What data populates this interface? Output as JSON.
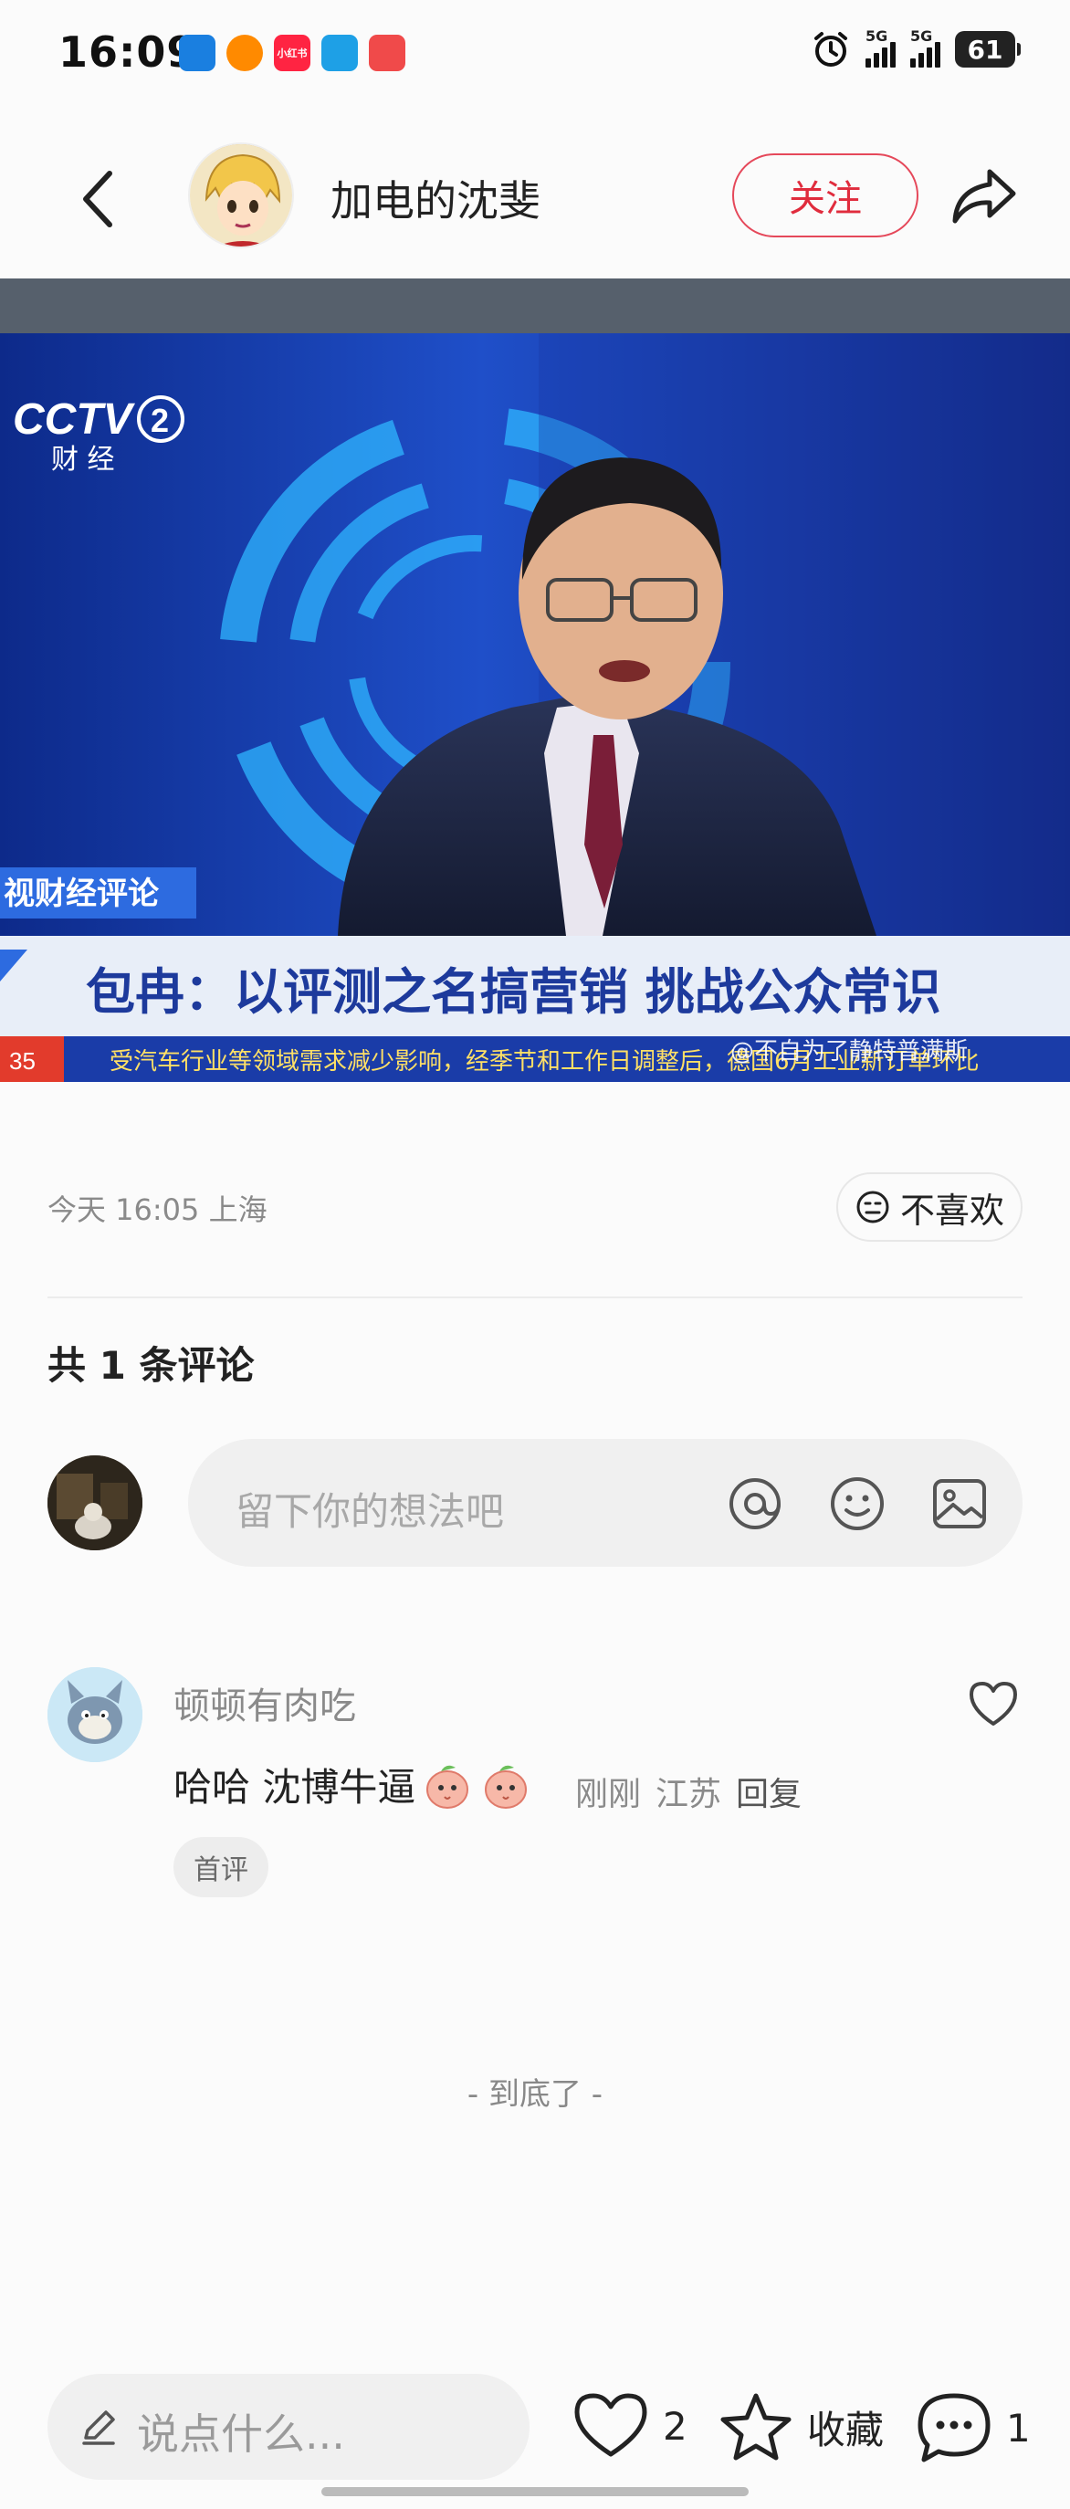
{
  "status_bar": {
    "time": "16:09",
    "signal_1": "5G",
    "signal_2": "5G",
    "battery": "61",
    "app_icons": [
      "app-icon-blue",
      "app-icon-orange",
      "app-icon-xiaohongshu",
      "app-icon-cyan",
      "app-icon-red"
    ],
    "xiaohongshu_label": "小红书"
  },
  "header": {
    "author_name": "加电的沈斐",
    "follow_label": "关注"
  },
  "post_image": {
    "channel_logo": "CCTV",
    "channel_number": "2",
    "channel_name": "财 经",
    "program_strip": "视财经评论",
    "headline": "包冉：以评测之名搞营销 挑战公众常识",
    "ticker": "受汽车行业等领域需求减少影响，经季节和工作日调整后，德国6月工业新订单环比",
    "ticker_number": "35",
    "watermark": "@不自为了静特普满斯"
  },
  "meta": {
    "time_location": "今天 16:05 上海",
    "dislike_label": "不喜欢"
  },
  "comments": {
    "count_label": "共 1 条评论",
    "input_placeholder": "留下你的想法吧",
    "items": [
      {
        "user": "顿顿有肉吃",
        "text": "哈哈 沈博牛逼",
        "time": "刚刚",
        "location": "江苏",
        "reply_label": "回复",
        "tag": "首评"
      }
    ],
    "end_tip": "- 到底了 -"
  },
  "bottom_bar": {
    "say_placeholder": "说点什么...",
    "like_count": "2",
    "collect_label": "收藏",
    "comment_count": "1"
  },
  "colors": {
    "accent_red": "#e02c3d",
    "text_gray": "#8a8a8a",
    "input_bg": "#f0f0f0"
  }
}
